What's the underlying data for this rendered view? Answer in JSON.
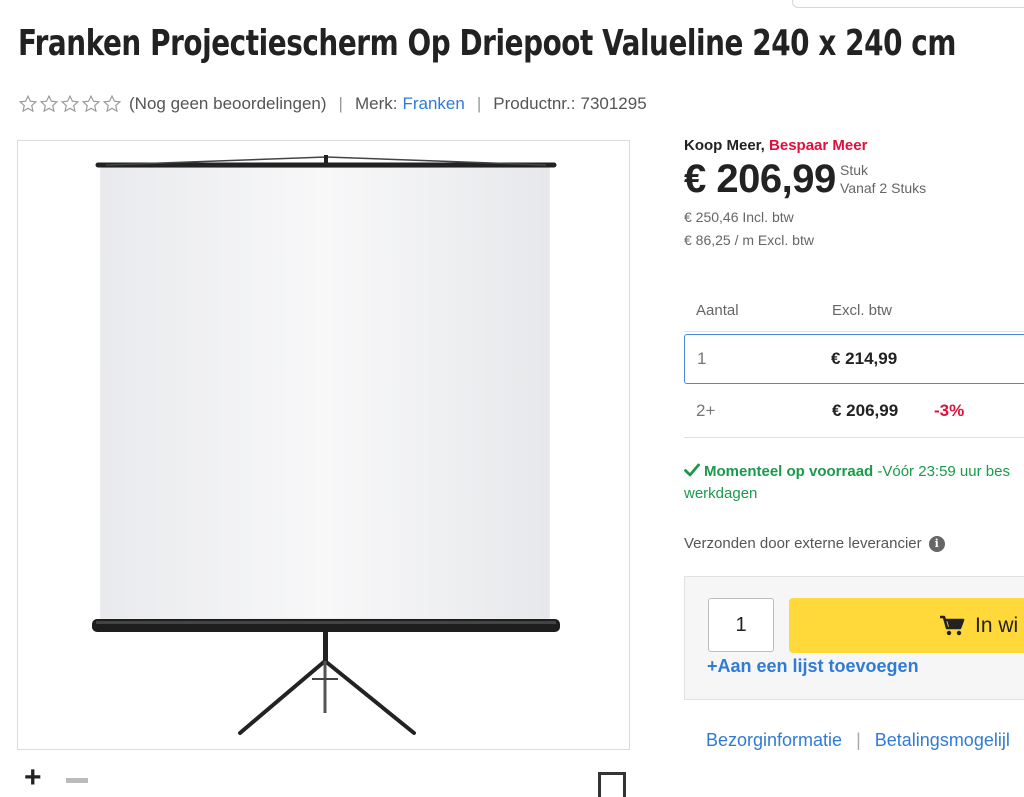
{
  "product": {
    "title": "Franken Projectiescherm Op Driepoot Valueline 240 x 240 cm",
    "reviews_text": "(Nog geen beoordelingen)",
    "rating_stars": 0,
    "brand_label": "Merk:",
    "brand": "Franken",
    "productnr_label": "Productnr.:",
    "productnr": "7301295",
    "separator": "|"
  },
  "pricing": {
    "promo_prefix": "Koop Meer,",
    "promo_highlight": "Bespaar Meer",
    "price": "€ 206,99",
    "unit": "Stuk",
    "from_qty": "Vanaf 2 Stuks",
    "incl_btw": "€ 250,46 Incl. btw",
    "per_meter": "€ 86,25 / m Excl. btw",
    "tiers_header": {
      "qty": "Aantal",
      "excl": "Excl. btw"
    },
    "tiers": [
      {
        "qty": "1",
        "price": "€ 214,99",
        "discount": ""
      },
      {
        "qty": "2+",
        "price": "€ 206,99",
        "discount": "-3%"
      }
    ]
  },
  "stock": {
    "status": "Momenteel op voorraad",
    "delivery": "-Vóór 23:59 uur bes",
    "delivery_line2": "werkdagen"
  },
  "supplier_text": "Verzonden door externe leverancier",
  "cart": {
    "quantity": "1",
    "add_button": "In wi",
    "add_to_list": "+Aan een lijst toevoegen"
  },
  "info_links": [
    "Bezorginformatie",
    "Betalingsmogelijl"
  ],
  "colors": {
    "accent_blue": "#2f7bd6",
    "promo_red": "#e0103a",
    "stock_green": "#1a9a4a",
    "cart_yellow": "#ffd83a"
  },
  "icons": {
    "star": "star-outline-icon",
    "check": "checkmark-icon",
    "info": "info-circle-icon",
    "cart": "shopping-cart-icon",
    "zoom_in": "plus-icon",
    "zoom_out": "minus-icon",
    "fullscreen": "expand-icon"
  }
}
